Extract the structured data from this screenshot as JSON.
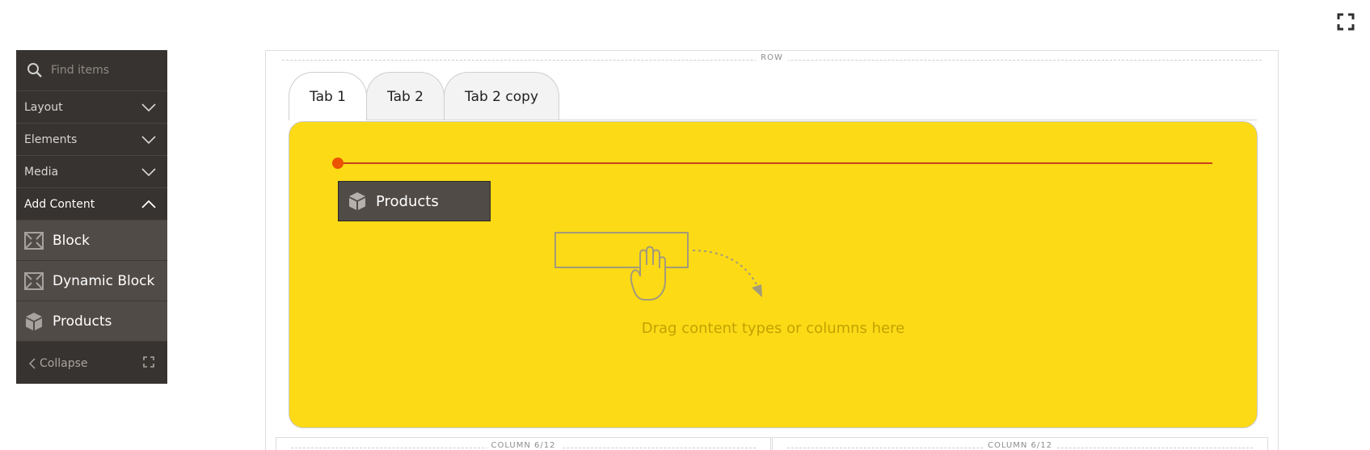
{
  "sidebar": {
    "search_placeholder": "Find items",
    "groups": [
      {
        "label": "Layout",
        "expanded": false
      },
      {
        "label": "Elements",
        "expanded": false
      },
      {
        "label": "Media",
        "expanded": false
      },
      {
        "label": "Add Content",
        "expanded": true
      }
    ],
    "items": [
      {
        "label": "Block",
        "icon": "block-icon"
      },
      {
        "label": "Dynamic Block",
        "icon": "dynamic-block-icon"
      },
      {
        "label": "Products",
        "icon": "products-icon"
      }
    ],
    "collapse_label": "Collapse"
  },
  "stage": {
    "row_label": "ROW",
    "tabs": [
      {
        "label": "Tab 1",
        "active": true
      },
      {
        "label": "Tab 2",
        "active": false
      },
      {
        "label": "Tab 2 copy",
        "active": false
      }
    ],
    "panel_color": "#fcda16",
    "products_label": "Products",
    "drop_text": "Drag content types or columns here",
    "columns": [
      {
        "label": "COLUMN 6/12"
      },
      {
        "label": "COLUMN 6/12"
      }
    ]
  },
  "colors": {
    "sidebar_bg": "#373330",
    "sidebar_item_bg": "#514b47",
    "accent": "#eb5202"
  }
}
